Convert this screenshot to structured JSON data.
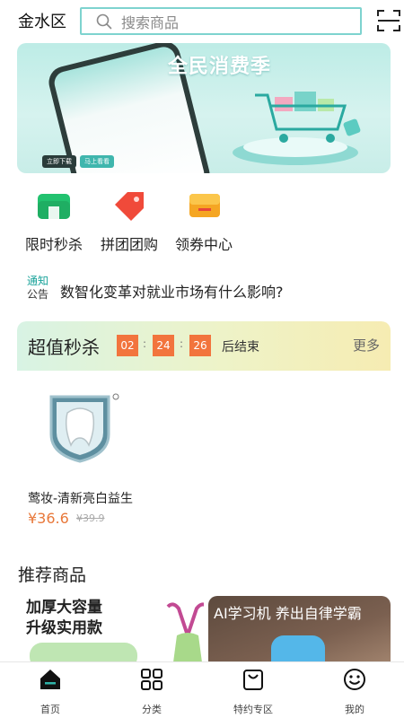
{
  "header": {
    "location": "金水区",
    "search_placeholder": "搜索商品"
  },
  "banner": {
    "title": "全民消费季",
    "button_download": "立即下载",
    "button_alt": "马上看看"
  },
  "quick_entries": [
    {
      "label": "限时秒杀",
      "icon": "wallet-icon",
      "color": "#1fbf6e"
    },
    {
      "label": "拼团团购",
      "icon": "tag-icon",
      "color": "#f04a3a"
    },
    {
      "label": "领券中心",
      "icon": "coupon-icon",
      "color": "#f5a623"
    }
  ],
  "notice": {
    "tag_top": "通知",
    "tag_bottom": "公告",
    "text": "数智化变革对就业市场有什么影响?"
  },
  "flash_sale": {
    "title": "超值秒杀",
    "countdown": {
      "hours": "02",
      "minutes": "24",
      "seconds": "26",
      "sep1": ":",
      "sep2": ":"
    },
    "end_text": "后结束",
    "more": "更多",
    "product": {
      "name": "莺妆-清新亮白益生",
      "price": "¥36.6",
      "original_price": "¥39.9"
    }
  },
  "recommend": {
    "title": "推荐商品",
    "card1_line1": "加厚大容量",
    "card1_line2": "升级实用款",
    "card2_text": "AI学习机  养出自律学霸"
  },
  "tabbar": [
    {
      "label": "首页",
      "icon": "home-icon",
      "active": true
    },
    {
      "label": "分类",
      "icon": "grid-icon",
      "active": false
    },
    {
      "label": "特约专区",
      "icon": "bag-icon",
      "active": false
    },
    {
      "label": "我的",
      "icon": "smile-icon",
      "active": false
    }
  ],
  "colors": {
    "accent": "#7ed3cf",
    "countdown": "#f2743d",
    "price": "#e8783a"
  }
}
